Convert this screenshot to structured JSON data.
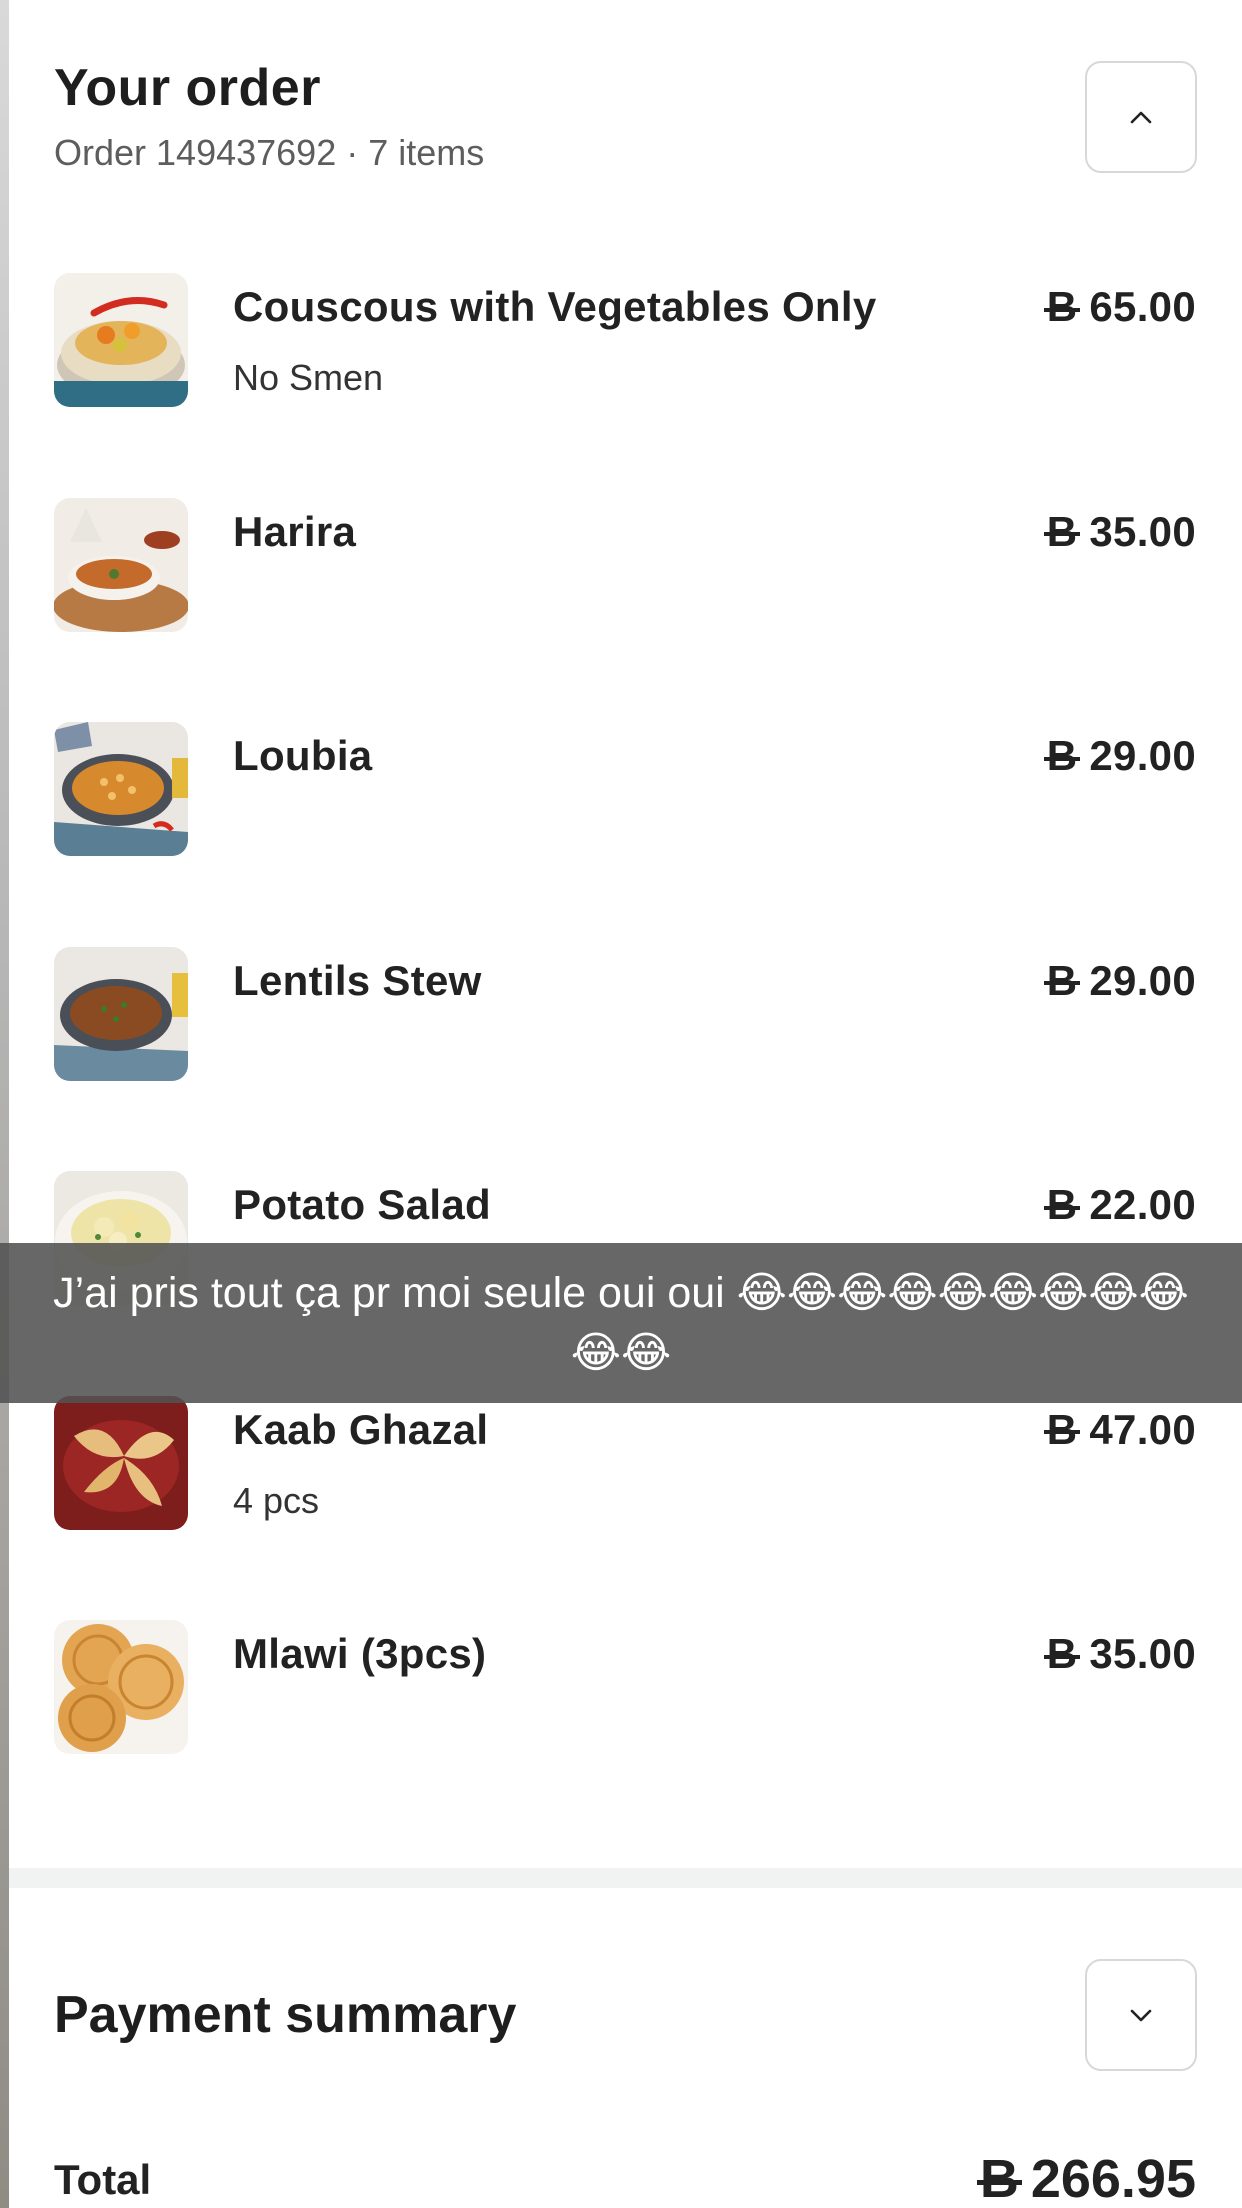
{
  "header": {
    "title": "Your order",
    "subtitle": "Order 149437692 · 7 items",
    "collapse_icon": "chevron-up-icon"
  },
  "currency_symbol": "B",
  "items": [
    {
      "name": "Couscous with Vegetables Only",
      "note": "No Smen",
      "price": "65.00",
      "image": "couscous-image"
    },
    {
      "name": "Harira",
      "note": "",
      "price": "35.00",
      "image": "harira-image"
    },
    {
      "name": "Loubia",
      "note": "",
      "price": "29.00",
      "image": "loubia-image"
    },
    {
      "name": "Lentils Stew",
      "note": "",
      "price": "29.00",
      "image": "lentils-image"
    },
    {
      "name": "Potato Salad",
      "note": "",
      "price": "22.00",
      "image": "potato-salad-image"
    },
    {
      "name": "Kaab Ghazal",
      "note": "4 pcs",
      "price": "47.00",
      "image": "kaab-ghazal-image"
    },
    {
      "name": "Mlawi (3pcs)",
      "note": "",
      "price": "35.00",
      "image": "mlawi-image"
    }
  ],
  "caption": {
    "text": "J’ai pris tout ça pr moi seule oui oui 😂😂😂😂😂😂😂😂😂😂😂"
  },
  "payment": {
    "title": "Payment summary",
    "expand_icon": "chevron-down-icon",
    "total_label": "Total",
    "total_value": "266.95"
  }
}
